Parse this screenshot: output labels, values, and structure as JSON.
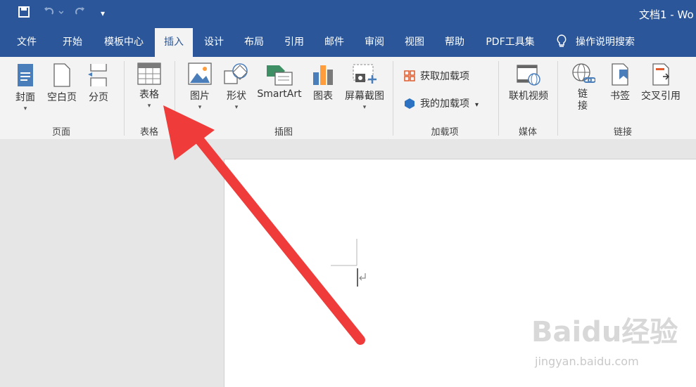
{
  "window": {
    "title": "文档1 - Wo"
  },
  "tabs": [
    "文件",
    "开始",
    "模板中心",
    "插入",
    "设计",
    "布局",
    "引用",
    "邮件",
    "审阅",
    "视图",
    "帮助",
    "PDF工具集"
  ],
  "search_label": "操作说明搜索",
  "ribbon": {
    "page_group": {
      "label": "页面",
      "cover": "封面",
      "blank": "空白页",
      "break": "分页"
    },
    "table_group": {
      "label": "表格",
      "table": "表格"
    },
    "illus_group": {
      "label": "插图",
      "picture": "图片",
      "shapes": "形状",
      "smartart": "SmartArt",
      "chart": "图表",
      "screenshot": "屏幕截图"
    },
    "addins_group": {
      "label": "加载项",
      "get": "获取加载项",
      "mine": "我的加载项"
    },
    "media_group": {
      "label": "媒体",
      "video": "联机视频"
    },
    "links_group": {
      "label": "链接",
      "link": "链\n接",
      "bookmark": "书签",
      "xref": "交叉引用"
    }
  },
  "watermark": {
    "main": "Baidu经验",
    "sub": "jingyan.baidu.com"
  },
  "colors": {
    "brand": "#2b579a",
    "arrow": "#f03b3b"
  }
}
